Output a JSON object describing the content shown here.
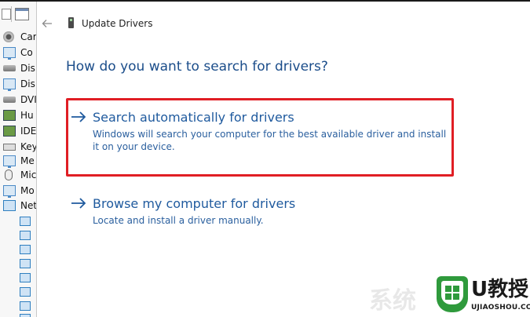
{
  "header": {
    "title": "Update Drivers",
    "back_icon": "back-arrow-icon"
  },
  "question": "How do you want to search for drivers?",
  "options": [
    {
      "title": "Search automatically for drivers",
      "description": "Windows will search your computer for the best available driver and install it on your device.",
      "icon": "arrow-right-icon",
      "highlighted": true
    },
    {
      "title": "Browse my computer for drivers",
      "description": "Locate and install a driver manually.",
      "icon": "arrow-right-icon",
      "highlighted": false
    }
  ],
  "highlight_color": "#e01e24",
  "accent_color": "#1f5a9e",
  "sidebar": {
    "items": [
      {
        "label": "Car",
        "icon": "camera-icon"
      },
      {
        "label": "Co",
        "icon": "monitor-icon"
      },
      {
        "label": "Dis",
        "icon": "disk-icon"
      },
      {
        "label": "Dis",
        "icon": "monitor-icon"
      },
      {
        "label": "DVI",
        "icon": "disk-icon"
      },
      {
        "label": "Hu",
        "icon": "chip-icon"
      },
      {
        "label": "IDE",
        "icon": "chip-icon"
      },
      {
        "label": "Key",
        "icon": "keyboard-icon"
      },
      {
        "label": "Me",
        "icon": "monitor-icon"
      },
      {
        "label": "Mic",
        "icon": "mouse-icon"
      },
      {
        "label": "Mo",
        "icon": "monitor-icon"
      },
      {
        "label": "Net",
        "icon": "network-icon"
      }
    ],
    "subitem_icon": "network-adapter-icon",
    "subitem_count": 9
  },
  "watermark": {
    "brand": "U教授",
    "url": "UJIAOSHOU.COM",
    "faint_text": "系统"
  }
}
